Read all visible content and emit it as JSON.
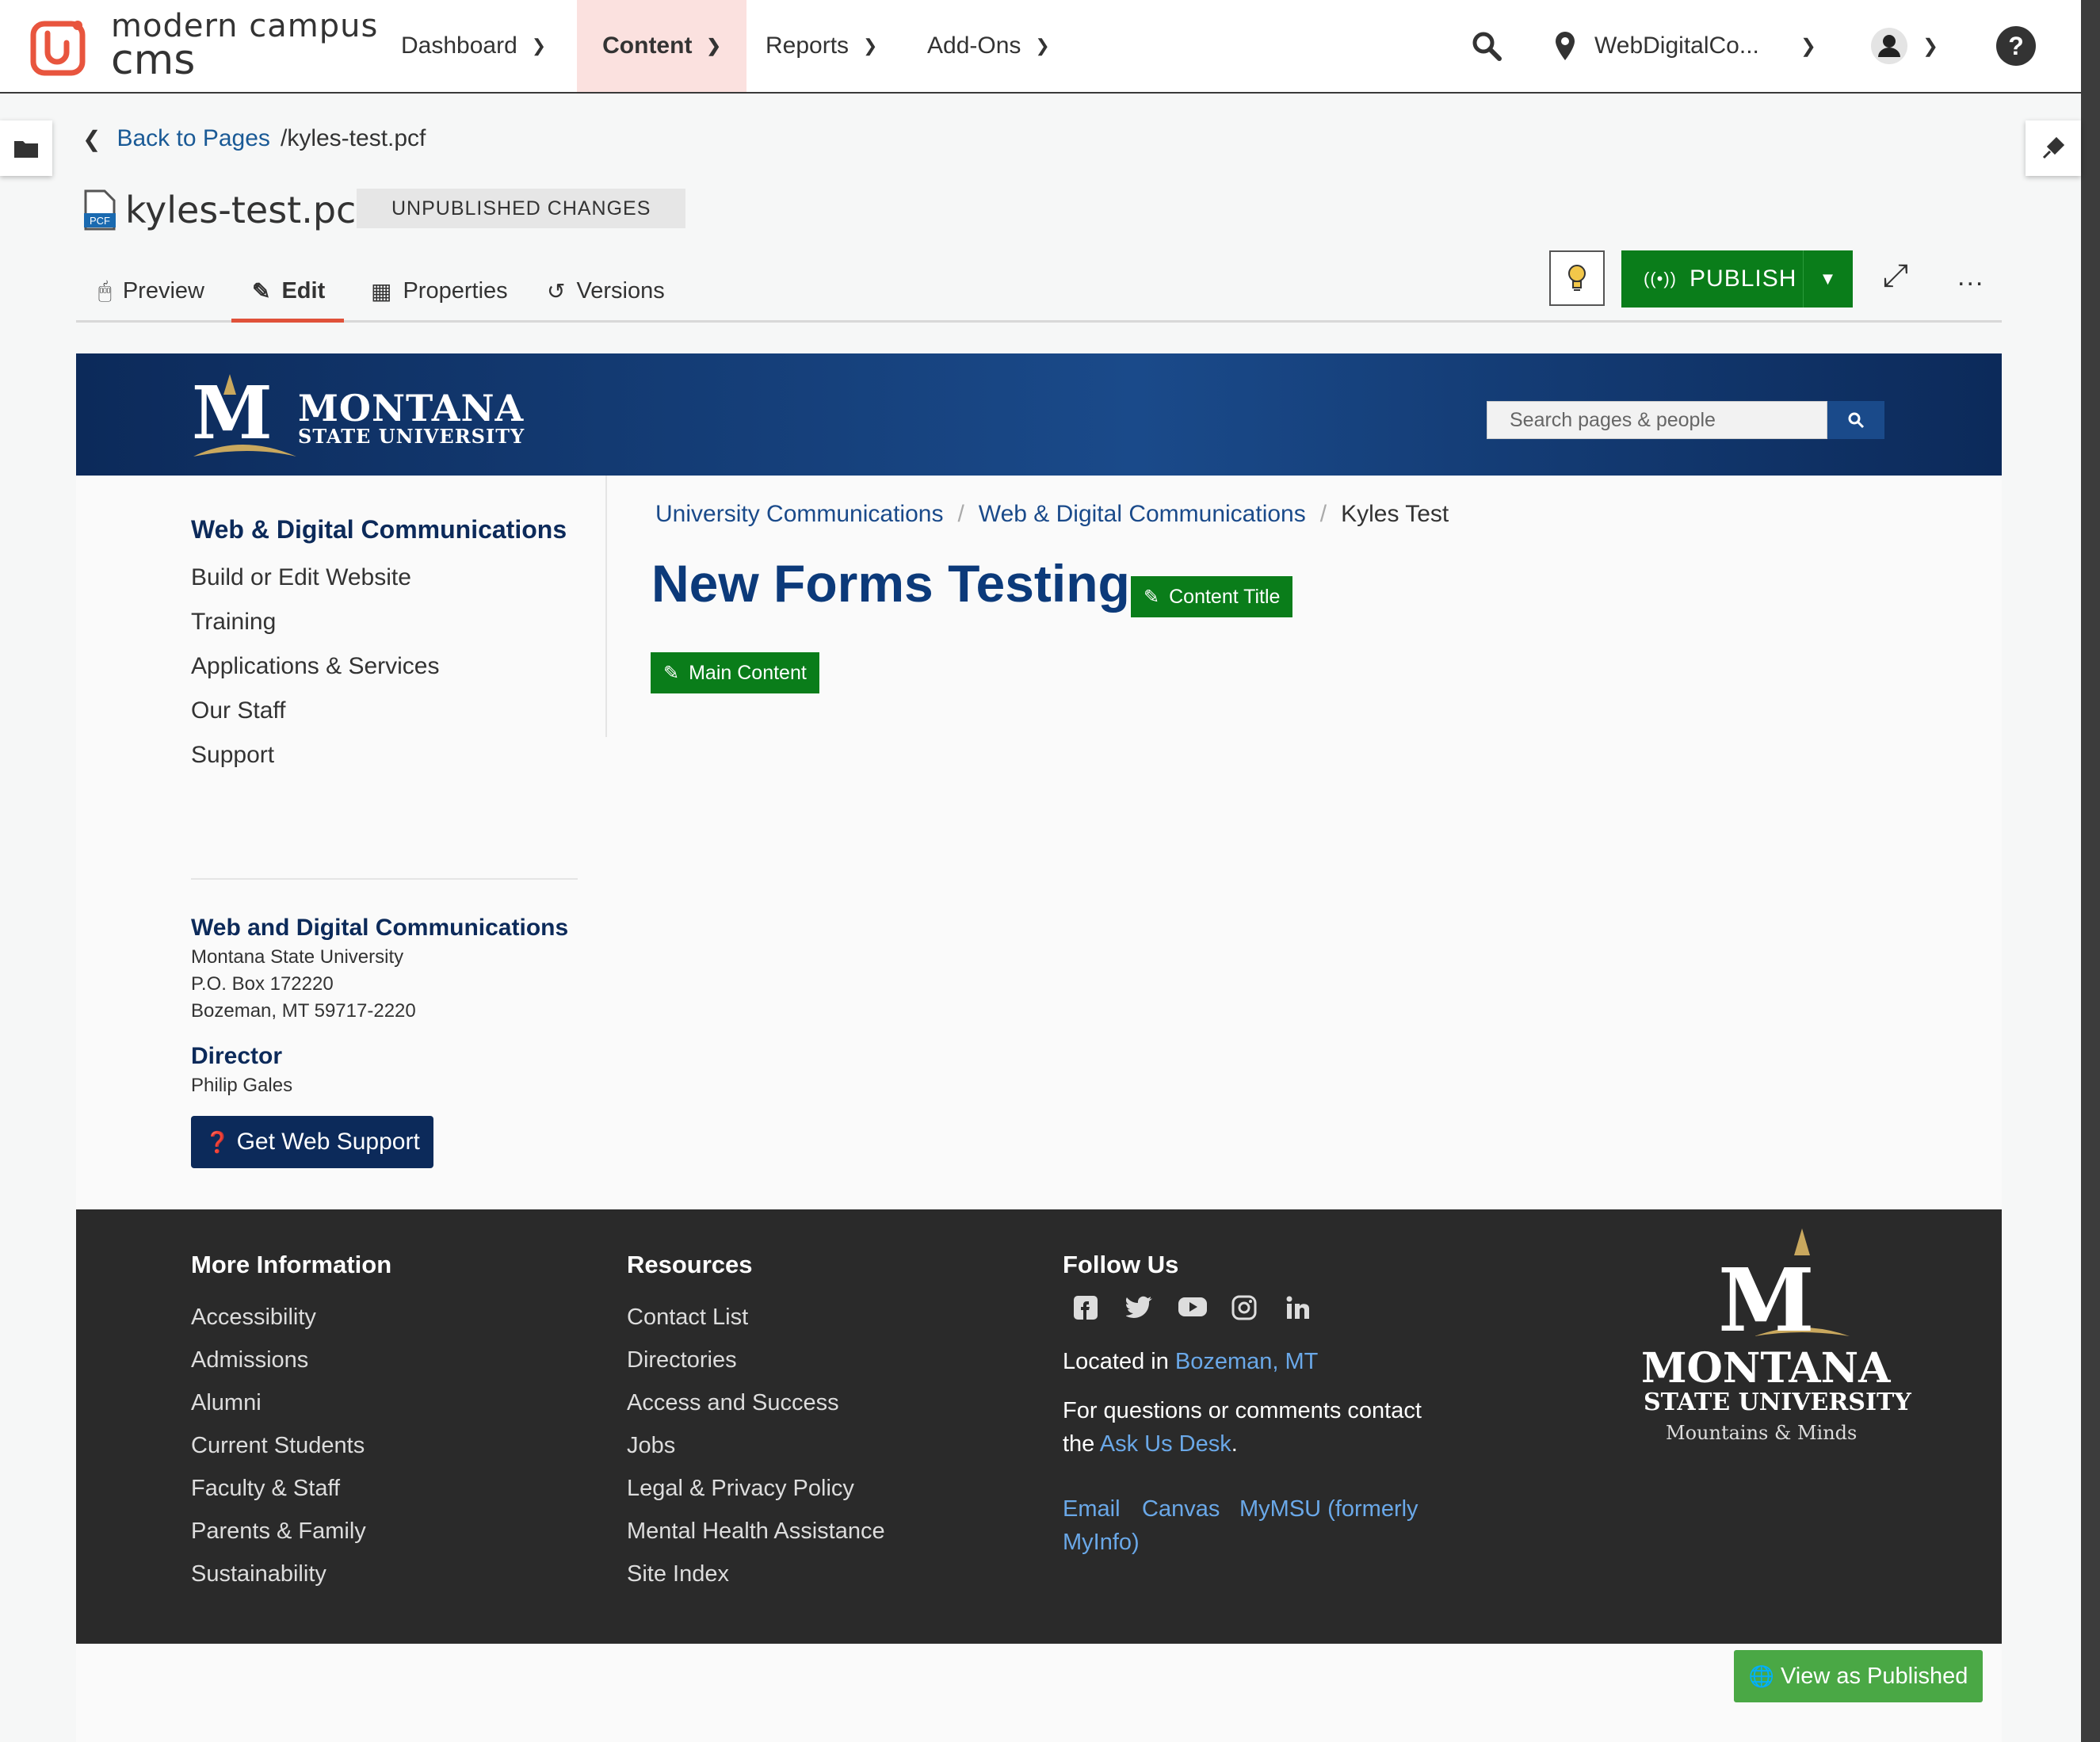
{
  "app": {
    "brand_line1": "modern campus",
    "brand_line2": "cms",
    "nav": [
      {
        "label": "Dashboard"
      },
      {
        "label": "Content"
      },
      {
        "label": "Reports"
      },
      {
        "label": "Add-Ons"
      }
    ],
    "site_name": "WebDigitalCo..."
  },
  "page": {
    "back_label": "Back to Pages",
    "path": "/kyles-test.pcf",
    "filename": "kyles-test.pcf",
    "file_badge": "PCF",
    "status_badge": "UNPUBLISHED CHANGES",
    "tabs": [
      {
        "label": "Preview"
      },
      {
        "label": "Edit"
      },
      {
        "label": "Properties"
      },
      {
        "label": "Versions"
      }
    ],
    "publish_label": "PUBLISH",
    "more_label": "..."
  },
  "site": {
    "logo_letter": "M",
    "logo_line1": "MONTANA",
    "logo_line2": "STATE UNIVERSITY",
    "search_placeholder": "Search pages & people",
    "left_nav": {
      "heading": "Web & Digital Communications",
      "items": [
        "Build or Edit Website",
        "Training",
        "Applications & Services",
        "Our Staff",
        "Support"
      ]
    },
    "contact": {
      "heading": "Web and Digital Communications",
      "lines": [
        "Montana State University",
        "P.O. Box 172220",
        "Bozeman, MT 59717-2220"
      ],
      "role_heading": "Director",
      "role_name": "Philip Gales",
      "support_button": "Get Web Support"
    },
    "breadcrumbs": [
      "University Communications",
      "Web & Digital Communications",
      "Kyles Test"
    ],
    "title": "New Forms Testing",
    "content_title_button": "Content Title",
    "main_content_button": "Main Content",
    "footer": {
      "more_info": {
        "heading": "More Information",
        "links": [
          "Accessibility",
          "Admissions",
          "Alumni",
          "Current Students",
          "Faculty & Staff",
          "Parents & Family",
          "Sustainability"
        ]
      },
      "resources": {
        "heading": "Resources",
        "links": [
          "Contact List",
          "Directories",
          "Access and Success",
          "Jobs",
          "Legal & Privacy Policy",
          "Mental Health Assistance",
          "Site Index"
        ]
      },
      "follow": {
        "heading": "Follow Us",
        "located_prefix": "Located in ",
        "located_link": "Bozeman, MT",
        "questions_line1": "For questions or comments contact",
        "questions_prefix": "the ",
        "questions_link": "Ask Us Desk",
        "questions_suffix": ".",
        "links": [
          "Email",
          "Canvas",
          "MyMSU (formerly",
          "MyInfo)"
        ]
      },
      "logo_letter": "M",
      "logo_line1": "MONTANA",
      "logo_line2": "STATE UNIVERSITY",
      "logo_line3": "Mountains & Minds"
    },
    "view_published": "View as Published"
  },
  "colors": {
    "brand_orange": "#e0523a",
    "publish_green": "#0a7d1a",
    "msu_blue": "#0c2a5a",
    "footer_bg": "#2a2a2a"
  }
}
